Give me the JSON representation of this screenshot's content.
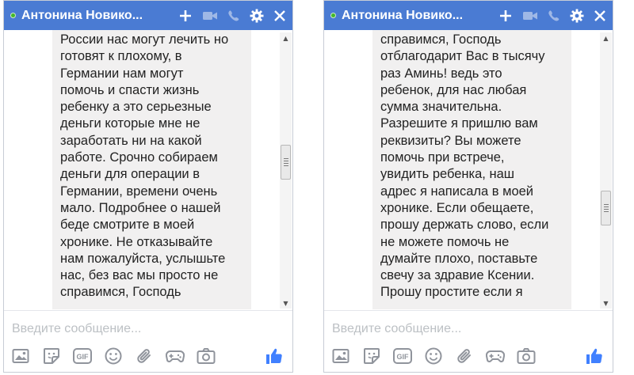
{
  "colors": {
    "header_bg": "#4a7bd3",
    "online": "#42b72a",
    "bubble_bg": "#f1f0f0",
    "icon_gray": "#90949c",
    "like_blue": "#4080ff"
  },
  "left_chat": {
    "contact_name": "Антонина Новико...",
    "message_text": "России нас могут лечить но\nготовят к плохому, в\nГермании нам могут\nпомочь и спасти жизнь\nребенку а это серьезные\nденьги которые мне не\nзаработать ни на какой\nработе. Срочно собираем\nденьги для операции в\nГермании, времени очень\nмало. Подробнее о нашей\nбеде смотрите в моей\nхронике. Не отказывайте\nнам пожалуйста, услышьте\nнас, без вас мы просто не\nсправимся, Господь",
    "input_placeholder": "Введите сообщение...",
    "gif_label": "GIF",
    "scroll_position": 0.45
  },
  "right_chat": {
    "contact_name": "Антонина Новико...",
    "message_text": "справимся, Господь\nотблагодарит Вас в тысячу\nраз Аминь! ведь это\nребенок, для нас любая\nсумма значительна.\nРазрешите я пришлю вам\nреквизиты? Вы можете\nпомочь при встрече,\nувидить ребенка, наш\nадрес я написала в моей\nхронике. Если обещаете,\nпрошу держать слово, если\nне можете помочь не\nдумайте плохо, поставьте\nсвечу за здравие Ксении.\nПрошу простите если я",
    "input_placeholder": "Введите сообщение...",
    "gif_label": "GIF",
    "scroll_position": 0.65
  },
  "icons": {
    "header": [
      "plus-icon",
      "video-camera-icon",
      "phone-icon",
      "gear-icon",
      "close-icon"
    ],
    "toolbar": [
      "photo-icon",
      "sticker-icon",
      "gif-icon",
      "emoji-icon",
      "attachment-icon",
      "game-controller-icon",
      "camera-icon"
    ],
    "send": "thumbs-up-icon"
  }
}
